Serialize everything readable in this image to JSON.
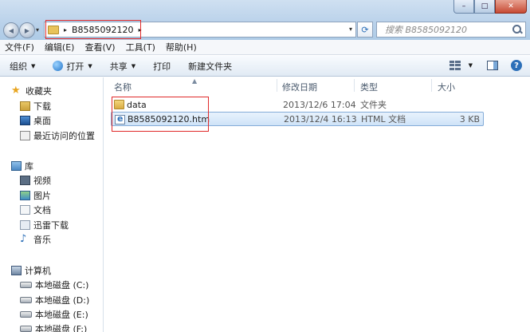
{
  "window": {
    "minimize_glyph": "–",
    "maximize_glyph": "□",
    "close_glyph": "✕"
  },
  "address": {
    "path": "B8585092120",
    "arrow_glyph": "▸",
    "dropdown_glyph": "▾"
  },
  "nav": {
    "back_glyph": "◀",
    "forward_glyph": "▶",
    "dropdown_glyph": "▾",
    "refresh_glyph": "⟳"
  },
  "search": {
    "placeholder": "搜索 B8585092120"
  },
  "menubar": {
    "items": [
      "文件(F)",
      "编辑(E)",
      "查看(V)",
      "工具(T)",
      "帮助(H)"
    ]
  },
  "toolbar": {
    "organize": "组织",
    "open": "打开",
    "share": "共享",
    "print": "打印",
    "new_folder": "新建文件夹",
    "caret_glyph": "▼",
    "help_glyph": "?"
  },
  "navpane": {
    "favorites": {
      "label": "收藏夹",
      "items": [
        "下载",
        "桌面",
        "最近访问的位置"
      ]
    },
    "libraries": {
      "label": "库",
      "items": [
        "视频",
        "图片",
        "文档",
        "迅雷下载",
        "音乐"
      ]
    },
    "computer": {
      "label": "计算机",
      "items": [
        "本地磁盘 (C:)",
        "本地磁盘 (D:)",
        "本地磁盘 (E:)",
        "本地磁盘 (F:)"
      ]
    },
    "star_glyph": "★",
    "music_glyph": "♪"
  },
  "columns": {
    "name": "名称",
    "date": "修改日期",
    "type": "类型",
    "size": "大小",
    "sort_glyph": "▲"
  },
  "files": [
    {
      "name": "data",
      "date": "2013/12/6 17:04",
      "type": "文件夹",
      "size": ""
    },
    {
      "name": "B8585092120.htm",
      "date": "2013/12/4 16:13",
      "type": "HTML 文档",
      "size": "3 KB"
    }
  ]
}
